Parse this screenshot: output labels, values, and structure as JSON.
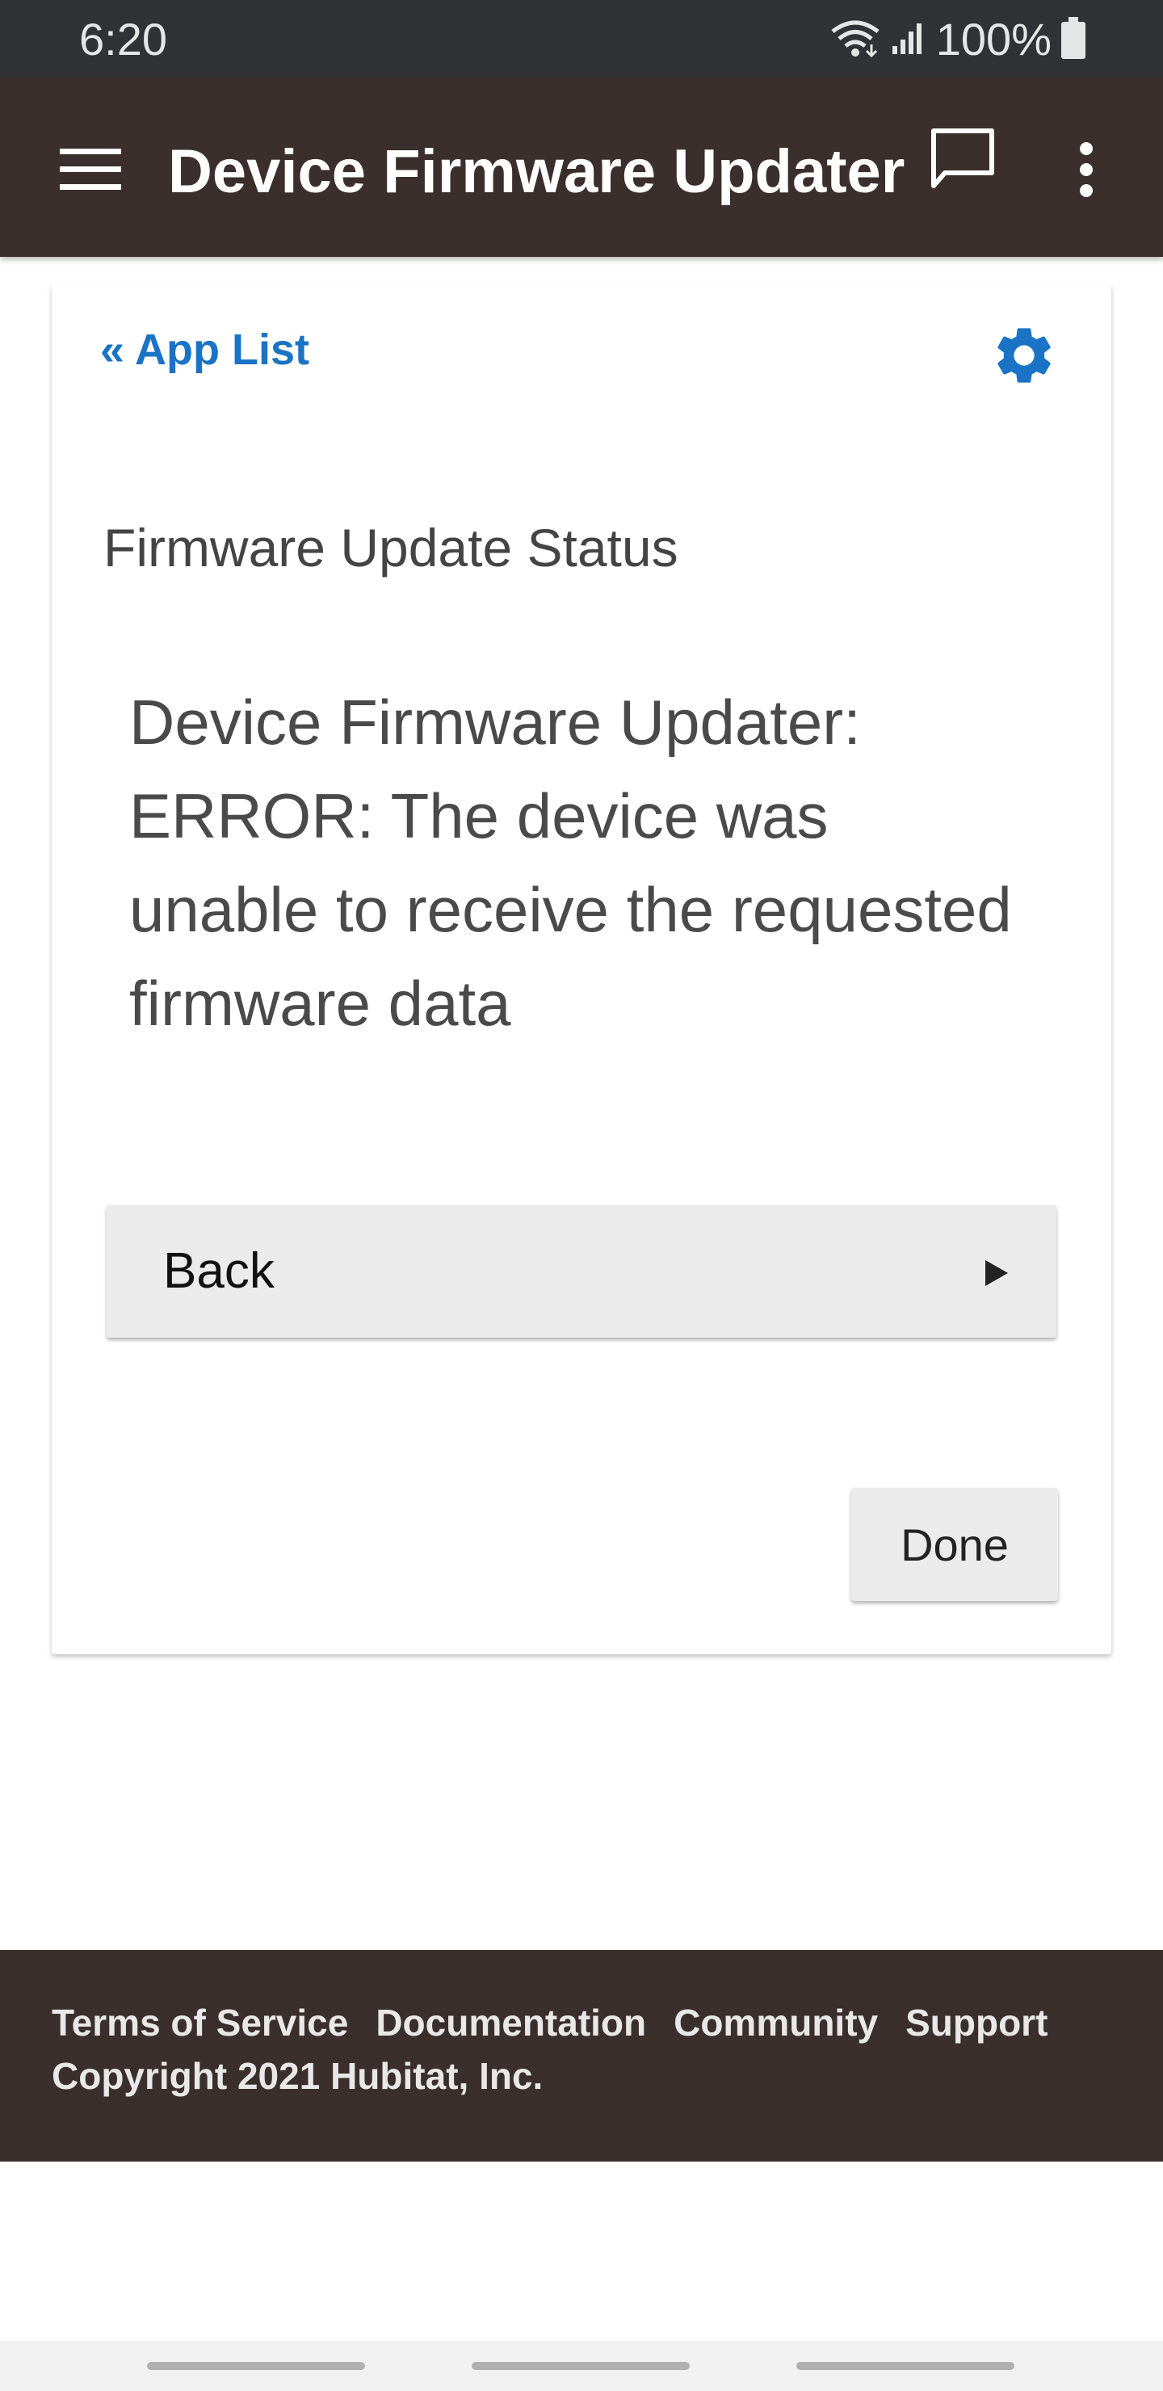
{
  "status_bar": {
    "time": "6:20",
    "battery": "100%",
    "icons": [
      "wifi-icon",
      "signal-icon",
      "battery-icon"
    ]
  },
  "app_bar": {
    "title": "Device Firmware Updater",
    "icons": [
      "menu-icon",
      "chat-icon",
      "more-vert-icon"
    ]
  },
  "card": {
    "back_link": "« App List",
    "settings_icon": "gear-icon",
    "section_title": "Firmware Update Status",
    "message": "Device Firmware Updater: ERROR: The device was unable to receive the requested firmware data",
    "back_row_label": "Back",
    "done_label": "Done"
  },
  "footer": {
    "links": [
      "Terms of Service",
      "Documentation",
      "Community",
      "Support"
    ],
    "copyright": "Copyright 2021 Hubitat, Inc."
  },
  "colors": {
    "app_bar": "#3a2f2c",
    "status_bar": "#303236",
    "link": "#1a73c4"
  }
}
